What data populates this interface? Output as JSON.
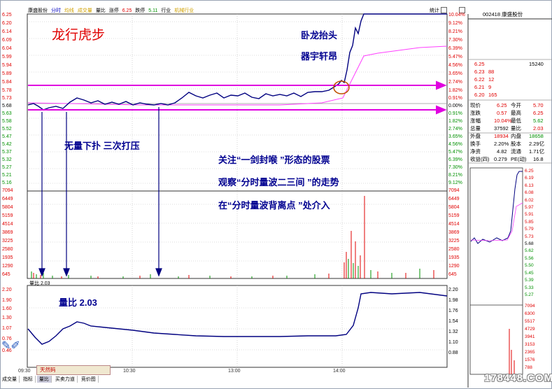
{
  "header": {
    "stock_name": "康盛股份",
    "tabs": [
      "分时",
      "均线",
      "成交量",
      "量比",
      "涨停",
      "6.25",
      "跌停",
      "5.11",
      "行业",
      "机械行业"
    ],
    "stats_btn": "统计"
  },
  "right_panel": {
    "code_title": "002418 康盛股份",
    "orderbook": [
      {
        "price": "6.25",
        "vol": "15240"
      },
      {
        "price": "6.23",
        "vol": "88"
      },
      {
        "price": "6.22",
        "vol": "12"
      },
      {
        "price": "6.21",
        "vol": "9"
      },
      {
        "price": "6.20",
        "vol": "165"
      }
    ],
    "quote": [
      {
        "k1": "现价",
        "v1": "6.25",
        "k2": "今开",
        "v2": "5.70"
      },
      {
        "k1": "涨跌",
        "v1": "0.57",
        "k2": "最高",
        "v2": "6.25"
      },
      {
        "k1": "涨幅",
        "v1": "10.04%",
        "k2": "最低",
        "v2": "5.62"
      },
      {
        "k1": "总量",
        "v1": "37592",
        "k2": "量比",
        "v2": "2.03"
      },
      {
        "k1": "外盘",
        "v1": "18934",
        "k2": "内盘",
        "v2": "18658"
      },
      {
        "k1": "换手",
        "v1": "2.20%",
        "k2": "股本",
        "v2": "2.29亿"
      },
      {
        "k1": "净资",
        "v1": "4.82",
        "k2": "流通",
        "v2": "1.71亿"
      },
      {
        "k1": "收益(四)",
        "v1": "0.279",
        "k2": "PE(动)",
        "v2": "16.8"
      }
    ],
    "mini_price_labels": [
      "6.25",
      "6.19",
      "6.13",
      "6.08",
      "6.02",
      "5.97",
      "5.91",
      "5.85",
      "5.79",
      "5.73",
      "5.68",
      "5.62",
      "5.56",
      "5.50",
      "5.45",
      "5.39",
      "5.33",
      "5.27"
    ],
    "mini_vol_labels": [
      "7094",
      "6300",
      "5517",
      "4729",
      "3941",
      "3153",
      "2365",
      "1576",
      "788"
    ]
  },
  "left_axis": {
    "price": [
      "6.25",
      "6.20",
      "6.14",
      "6.09",
      "6.04",
      "5.99",
      "5.94",
      "5.89",
      "5.84",
      "5.78",
      "5.73",
      "5.68",
      "5.63",
      "5.58",
      "5.52",
      "5.47",
      "5.42",
      "5.37",
      "5.32",
      "5.27",
      "5.21",
      "5.16",
      "7094",
      "6449",
      "5804",
      "5159",
      "4514",
      "3869",
      "3225",
      "2580",
      "1935",
      "1290",
      "645"
    ],
    "ratio": [
      "2.20",
      "1.90",
      "1.60",
      "1.30",
      "1.07",
      "0.76",
      "0.46"
    ]
  },
  "right_axis": {
    "pct": [
      "10.04%",
      "9.12%",
      "8.21%",
      "7.30%",
      "6.39%",
      "5.47%",
      "4.56%",
      "3.65%",
      "2.74%",
      "1.82%",
      "0.91%",
      "0.00%",
      "0.91%",
      "1.82%",
      "2.74%",
      "3.65%",
      "4.56%",
      "5.47%",
      "6.39%",
      "7.30%",
      "8.21%",
      "9.12%",
      "7094",
      "6449",
      "5804",
      "5159",
      "4514",
      "3869",
      "3225",
      "2580",
      "1935",
      "1290",
      "645"
    ],
    "ratio": [
      "2.20",
      "1.98",
      "1.76",
      "1.54",
      "1.32",
      "1.10",
      "0.88"
    ]
  },
  "volume_ratio_label": "量比 2.03",
  "time_axis": [
    "09:30",
    "10:30",
    "13:00",
    "14:00"
  ],
  "bottom_tabs": [
    "成交量",
    "指标",
    "量比",
    "买卖力道",
    "竞价图"
  ],
  "annotations": {
    "title": "龙行虎步",
    "wolong1": "卧龙抬头",
    "wolong2": "器宇轩昂",
    "wuliang": "无量下扑  三次打压",
    "focus1": "关注“一剑封喉 ”形态的股票",
    "focus2": "观察“分时量波二三间 ”的走势",
    "focus3": "在“分时量波背离点 ”处介入",
    "ratio_text": "量比 2.03"
  },
  "logo": {
    "tools": "天然码",
    "watermark": "178448.COM"
  },
  "colors": {
    "price_line": "#000080",
    "avg_line": "#ff40ff",
    "magenta_arrow": "#e000e0",
    "red": "#e00000",
    "green": "#009000",
    "annotation_blue": "#000090",
    "title_red": "#e00000"
  }
}
